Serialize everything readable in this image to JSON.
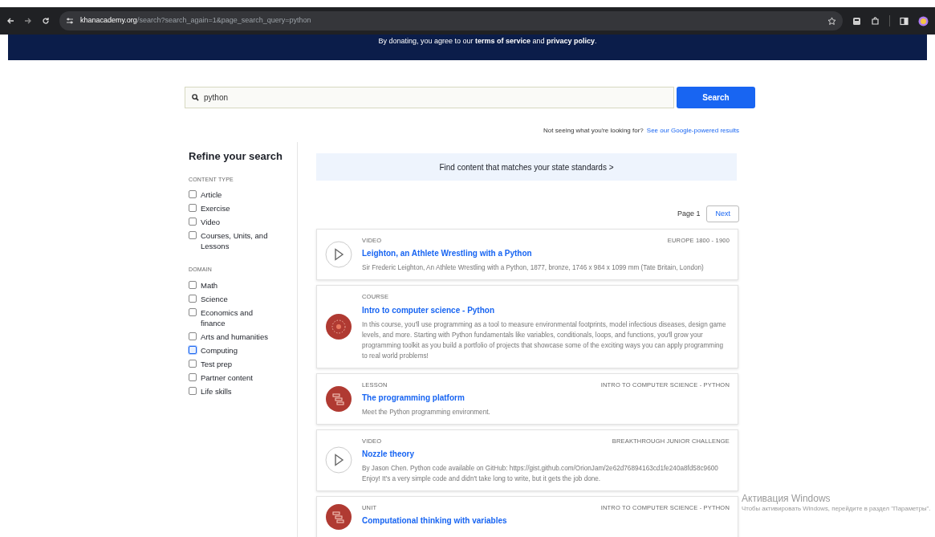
{
  "browser": {
    "url_host": "khanacademy.org",
    "url_path": "/search?search_again=1&page_search_query=python"
  },
  "banner": {
    "text": "By donating, you agree to our **terms of service** and **privacy policy**."
  },
  "search": {
    "value": "python",
    "button": "Search"
  },
  "google_note": {
    "text": "Not seeing what you're looking for?",
    "link": "See our Google-powered results"
  },
  "sidebar": {
    "title": "Refine your search",
    "groups": [
      {
        "heading": "CONTENT TYPE",
        "items": [
          {
            "label": "Article",
            "checked": false,
            "focused": false
          },
          {
            "label": "Exercise",
            "checked": false,
            "focused": false
          },
          {
            "label": "Video",
            "checked": false,
            "focused": false
          },
          {
            "label": "Courses, Units, and Lessons",
            "checked": false,
            "focused": false
          }
        ]
      },
      {
        "heading": "DOMAIN",
        "items": [
          {
            "label": "Math",
            "checked": false,
            "focused": false
          },
          {
            "label": "Science",
            "checked": false,
            "focused": false
          },
          {
            "label": "Economics and finance",
            "checked": false,
            "focused": false
          },
          {
            "label": "Arts and humanities",
            "checked": false,
            "focused": false
          },
          {
            "label": "Computing",
            "checked": false,
            "focused": true
          },
          {
            "label": "Test prep",
            "checked": false,
            "focused": false
          },
          {
            "label": "Partner content",
            "checked": false,
            "focused": false
          },
          {
            "label": "Life skills",
            "checked": false,
            "focused": false
          }
        ]
      }
    ]
  },
  "standards_banner": "Find content that matches your state standards >",
  "pagination": {
    "page": "Page 1",
    "next": "Next"
  },
  "results": [
    {
      "kind": "video",
      "type": "VIDEO",
      "context": "EUROPE 1800 - 1900",
      "title": "Leighton, an Athlete Wrestling with a Python",
      "description": "Sir Frederic Leighton, An Athlete Wrestling with a Python, 1877, bronze, 1746 x 984 x 1099 mm (Tate Britain, London)"
    },
    {
      "kind": "course",
      "type": "COURSE",
      "title": "Intro to computer science - Python",
      "description": "In this course, you'll use programming as a tool to measure environmental footprints, model infectious diseases, design game levels, and more. Starting with Python fundamentals like variables, conditionals, loops, and functions, you'll grow your programming toolkit as you build a portfolio of projects that showcase some of the exciting ways you can apply programming to real world problems!"
    },
    {
      "kind": "lesson",
      "type": "LESSON",
      "context": "INTRO TO COMPUTER SCIENCE - PYTHON",
      "title": "The programming platform",
      "description": "Meet the Python programming environment."
    },
    {
      "kind": "video",
      "type": "VIDEO",
      "context": "BREAKTHROUGH JUNIOR CHALLENGE",
      "title": "Nozzle theory",
      "description": "By Jason Chen. Python code available on GitHub: https://gist.github.com/OrionJam/2e62d76894163cd1fe240a8fd58c9600 Enjoy! It's a very simple code and didn't take long to write, but it gets the job done."
    },
    {
      "kind": "lesson",
      "type": "UNIT",
      "context": "INTRO TO COMPUTER SCIENCE - PYTHON",
      "title": "Computational thinking with variables"
    }
  ],
  "os_notice": {
    "title": "Активация Windows",
    "text": "Чтобы активировать Windows, перейдите в раздел \"Параметры\"."
  }
}
